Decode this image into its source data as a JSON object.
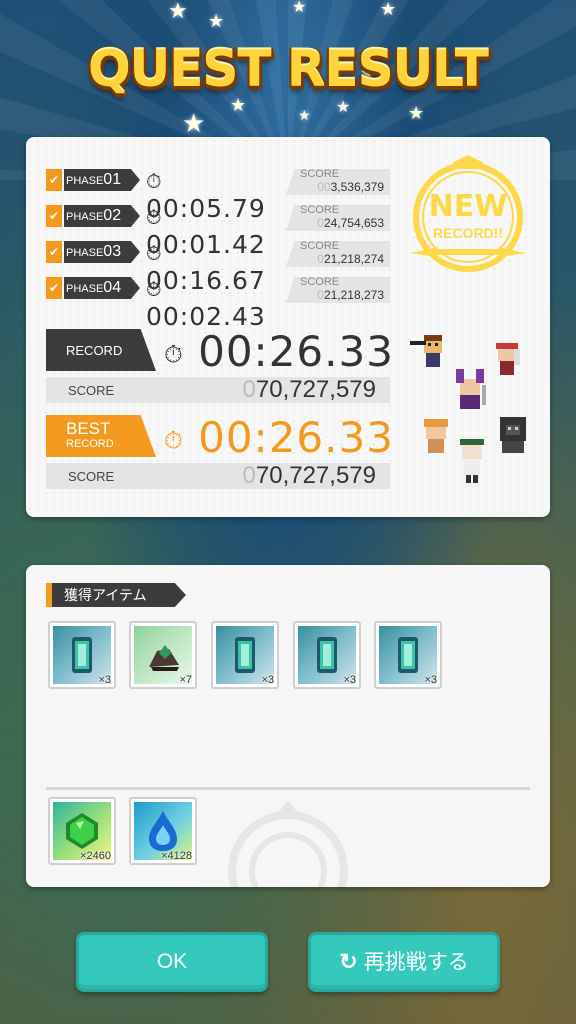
{
  "title": "QUEST RESULT",
  "phases": [
    {
      "label": "PHASE",
      "num": "01",
      "time": "00:05.79",
      "score_label": "SCORE",
      "score_dim": "00",
      "score": "3,536,379"
    },
    {
      "label": "PHASE",
      "num": "02",
      "time": "00:01.42",
      "score_label": "SCORE",
      "score_dim": "0",
      "score": "24,754,653"
    },
    {
      "label": "PHASE",
      "num": "03",
      "time": "00:16.67",
      "score_label": "SCORE",
      "score_dim": "0",
      "score": "21,218,274"
    },
    {
      "label": "PHASE",
      "num": "04",
      "time": "00:02.43",
      "score_label": "SCORE",
      "score_dim": "0",
      "score": "21,218,273"
    }
  ],
  "record": {
    "label": "RECORD",
    "time": "00:26.33",
    "score_label": "SCORE",
    "score_dim": "0",
    "score": "70,727,579"
  },
  "best": {
    "label1": "BEST",
    "label2": "RECORD",
    "time": "00:26.33",
    "score_label": "SCORE",
    "score_dim": "0",
    "score": "70,727,579"
  },
  "stamp": {
    "line1": "NEW",
    "line2": "RECORD!!"
  },
  "items": {
    "header": "獲得アイテム",
    "list": [
      {
        "icon": "blue-crystal-icon",
        "qty": "×3"
      },
      {
        "icon": "ore-icon",
        "qty": "×7"
      },
      {
        "icon": "blue-crystal-icon",
        "qty": "×3"
      },
      {
        "icon": "blue-crystal-icon",
        "qty": "×3"
      },
      {
        "icon": "blue-crystal-icon",
        "qty": "×3"
      }
    ],
    "currency": [
      {
        "icon": "green-gem-icon",
        "qty": "×2460"
      },
      {
        "icon": "blue-drop-icon",
        "qty": "×4128"
      }
    ]
  },
  "buttons": {
    "ok": "OK",
    "retry": "再挑戦する"
  },
  "colors": {
    "accent": "#f39a1e",
    "dark": "#3c3c3c",
    "button": "#35c9bd",
    "stamp": "#ffd84a"
  }
}
